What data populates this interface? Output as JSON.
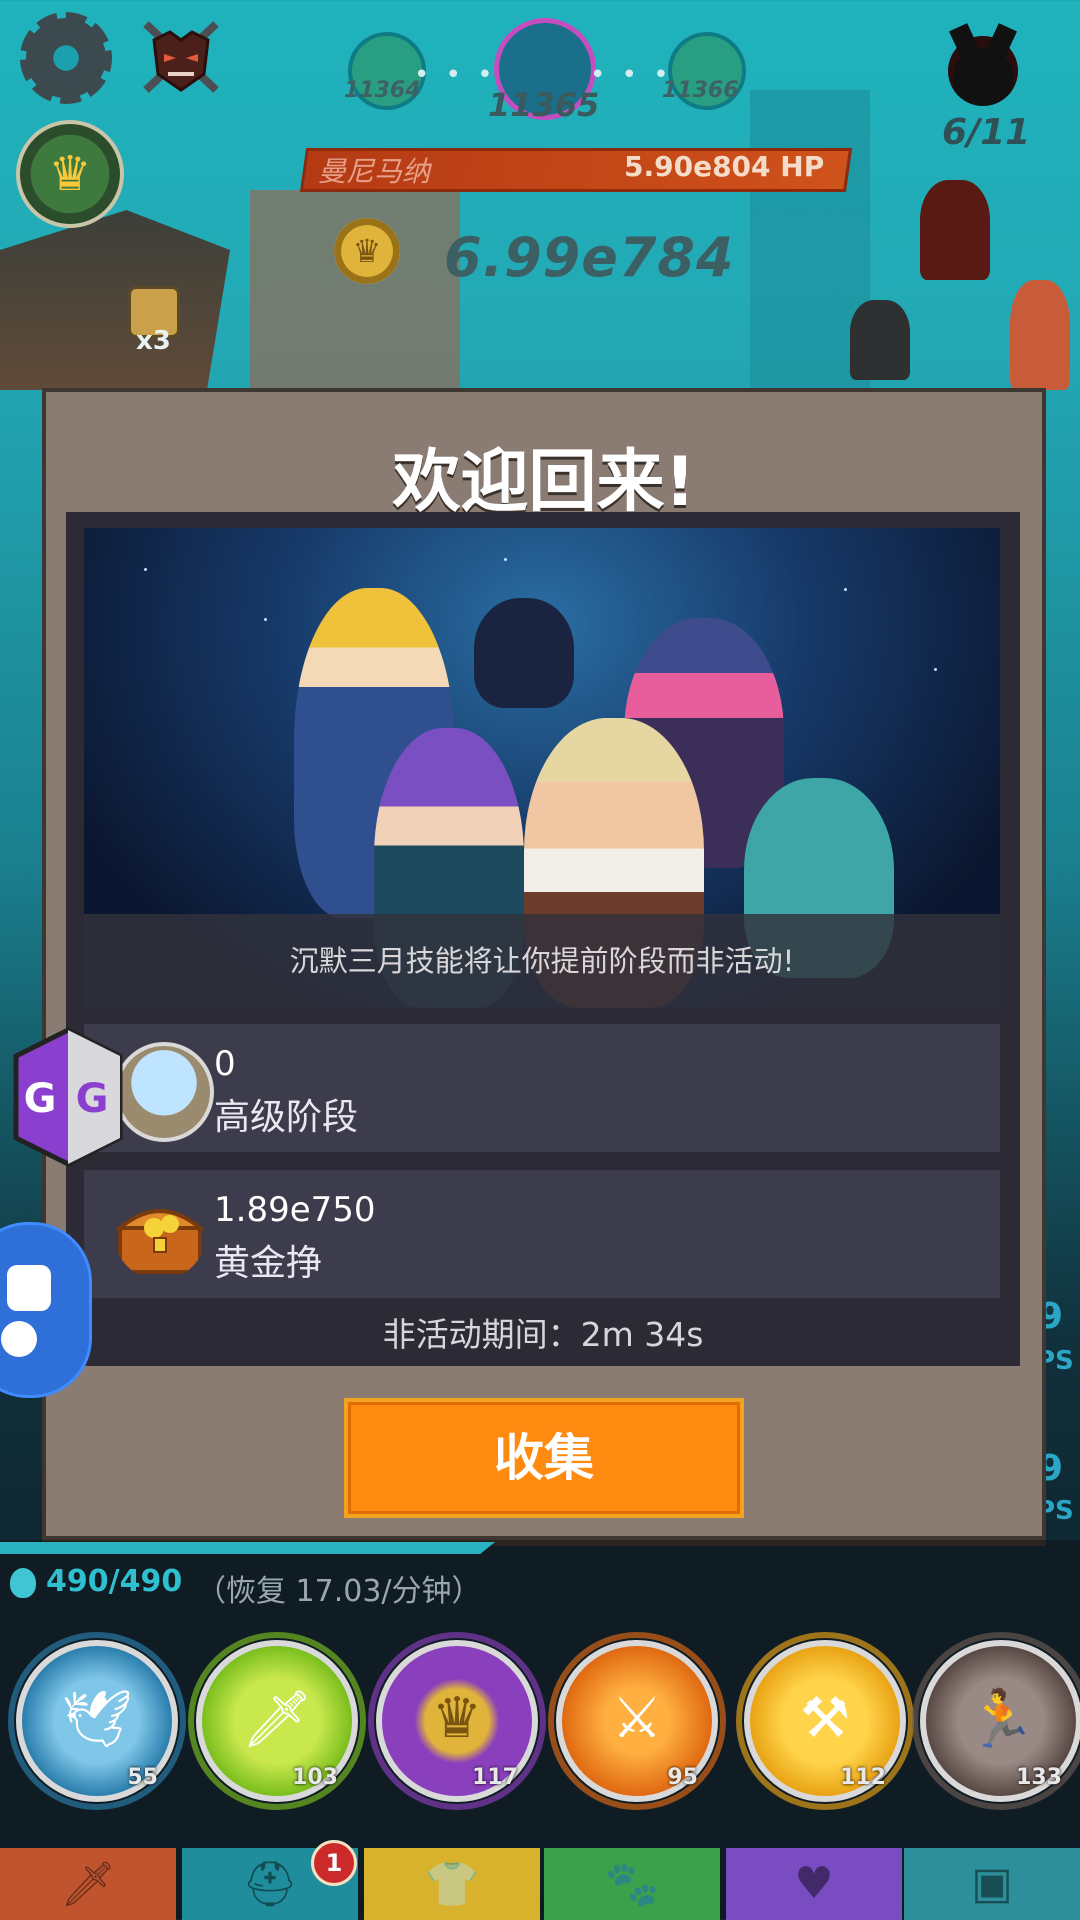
{
  "hud": {
    "stage_prev": "11364",
    "stage_current": "11365",
    "stage_next": "11366",
    "dots": "• • •",
    "wave": "6/11",
    "boss_name": "曼尼马纳",
    "boss_hp": "5.90e804 HP",
    "gold": "6.99e784",
    "multiplier": "x3"
  },
  "dialog": {
    "title": "欢迎回来!",
    "banner_caption": "沉默三月技能将让你提前阶段而非活动!",
    "rows": [
      {
        "value": "0",
        "label": "高级阶段",
        "icon": "castle-flag-icon"
      },
      {
        "value": "1.89e750",
        "label": "黄金挣",
        "icon": "treasure-chest-icon"
      }
    ],
    "inactive_label": "非活动期间：",
    "inactive_time": "2m 34s",
    "collect_label": "收集"
  },
  "mana": {
    "current": "490/490",
    "regen": "（恢复 17.03/分钟）"
  },
  "skills": [
    {
      "level": "55",
      "icon": "phoenix-wings-icon",
      "color": "#2c7fae"
    },
    {
      "level": "103",
      "icon": "sword-green-icon",
      "color": "#7bbf1e"
    },
    {
      "level": "117",
      "icon": "coin-crown-icon",
      "color": "#8a3fbd"
    },
    {
      "level": "95",
      "icon": "sword-flame-icon",
      "color": "#e06a12"
    },
    {
      "level": "112",
      "icon": "weapons-crossed-icon",
      "color": "#e9a415"
    },
    {
      "level": "133",
      "icon": "running-ninja-icon",
      "color": "#6a5a55"
    }
  ],
  "tabs": [
    {
      "name": "tab-sword",
      "icon": "sword-icon",
      "color": "#c0542f"
    },
    {
      "name": "tab-heroes",
      "icon": "viking-helmet-icon",
      "color": "#1f8d9c",
      "badge": "1"
    },
    {
      "name": "tab-equipment",
      "icon": "shirt-icon",
      "color": "#d8b22c"
    },
    {
      "name": "tab-pets",
      "icon": "pet-icon",
      "color": "#3da04a"
    },
    {
      "name": "tab-clan",
      "icon": "heart-wings-icon",
      "color": "#7a4cc2"
    },
    {
      "name": "tab-shop",
      "icon": "chest-icon",
      "color": "#2c8f99"
    }
  ],
  "side_peek": {
    "a": "9",
    "b": "9",
    "c": "PS",
    "d": "PS"
  }
}
